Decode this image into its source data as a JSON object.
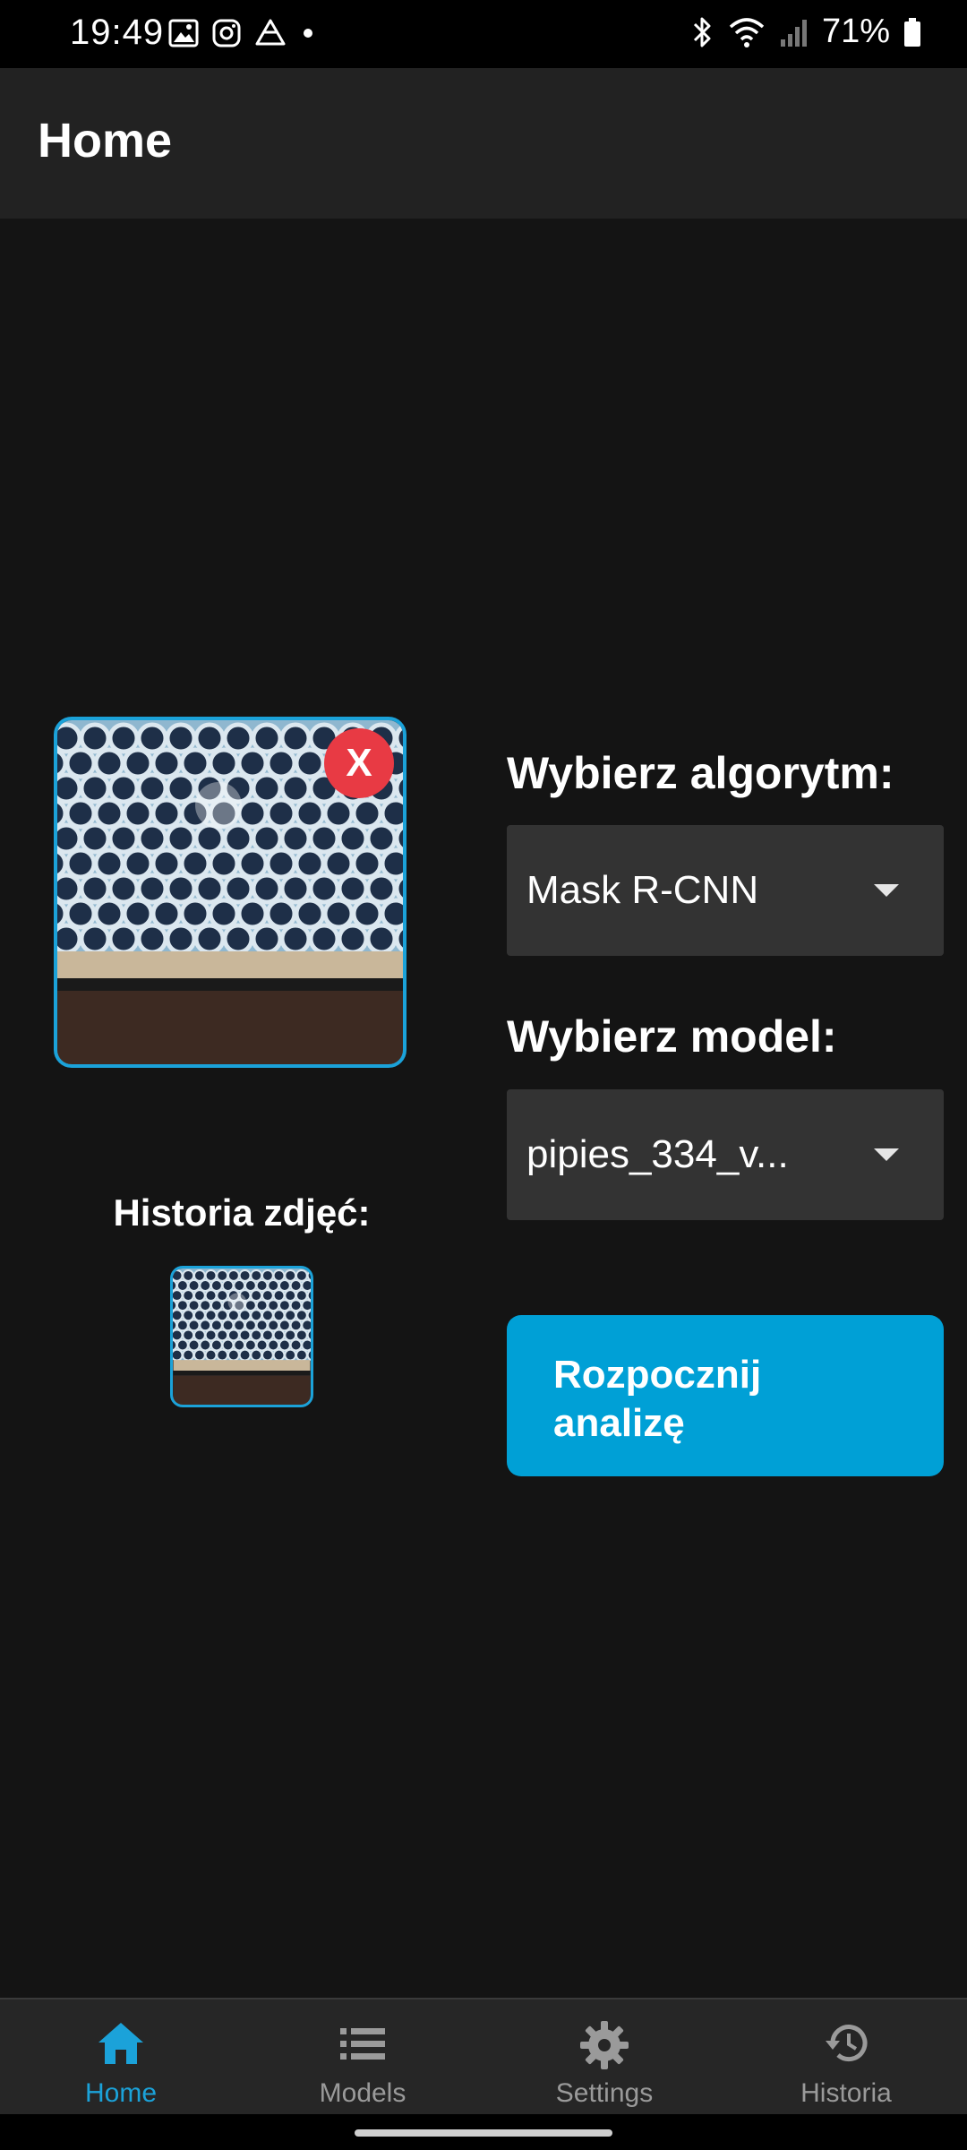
{
  "status_bar": {
    "time": "19:49",
    "battery_percent": "71%",
    "left_icons": [
      "gallery-icon",
      "instagram-icon",
      "drive-icon",
      "dot-icon"
    ],
    "right_icons": [
      "bluetooth-icon",
      "wifi-icon",
      "signal-icon",
      "battery-icon"
    ],
    "battery_level": 0.71
  },
  "app_bar": {
    "title": "Home"
  },
  "image_panel": {
    "close_label": "X",
    "history_title": "Historia zdjęć:"
  },
  "controls": {
    "algorithm_label": "Wybierz algorytm:",
    "algorithm_value": "Mask R-CNN",
    "model_label": "Wybierz model:",
    "model_value": "pipies_334_v...",
    "start_label_line1": "Rozpocznij",
    "start_label_line2": "analizę"
  },
  "bottom_nav": {
    "items": [
      {
        "label": "Home",
        "icon": "home-icon",
        "active": true
      },
      {
        "label": "Models",
        "icon": "list-icon",
        "active": false
      },
      {
        "label": "Settings",
        "icon": "gear-icon",
        "active": false
      },
      {
        "label": "Historia",
        "icon": "history-icon",
        "active": false
      }
    ]
  },
  "colors": {
    "accent": "#1ba2d9",
    "button": "#00a0d6",
    "close_badge": "#e83a44",
    "background": "#141414",
    "app_bar": "#222222",
    "dropdown": "#333333"
  }
}
